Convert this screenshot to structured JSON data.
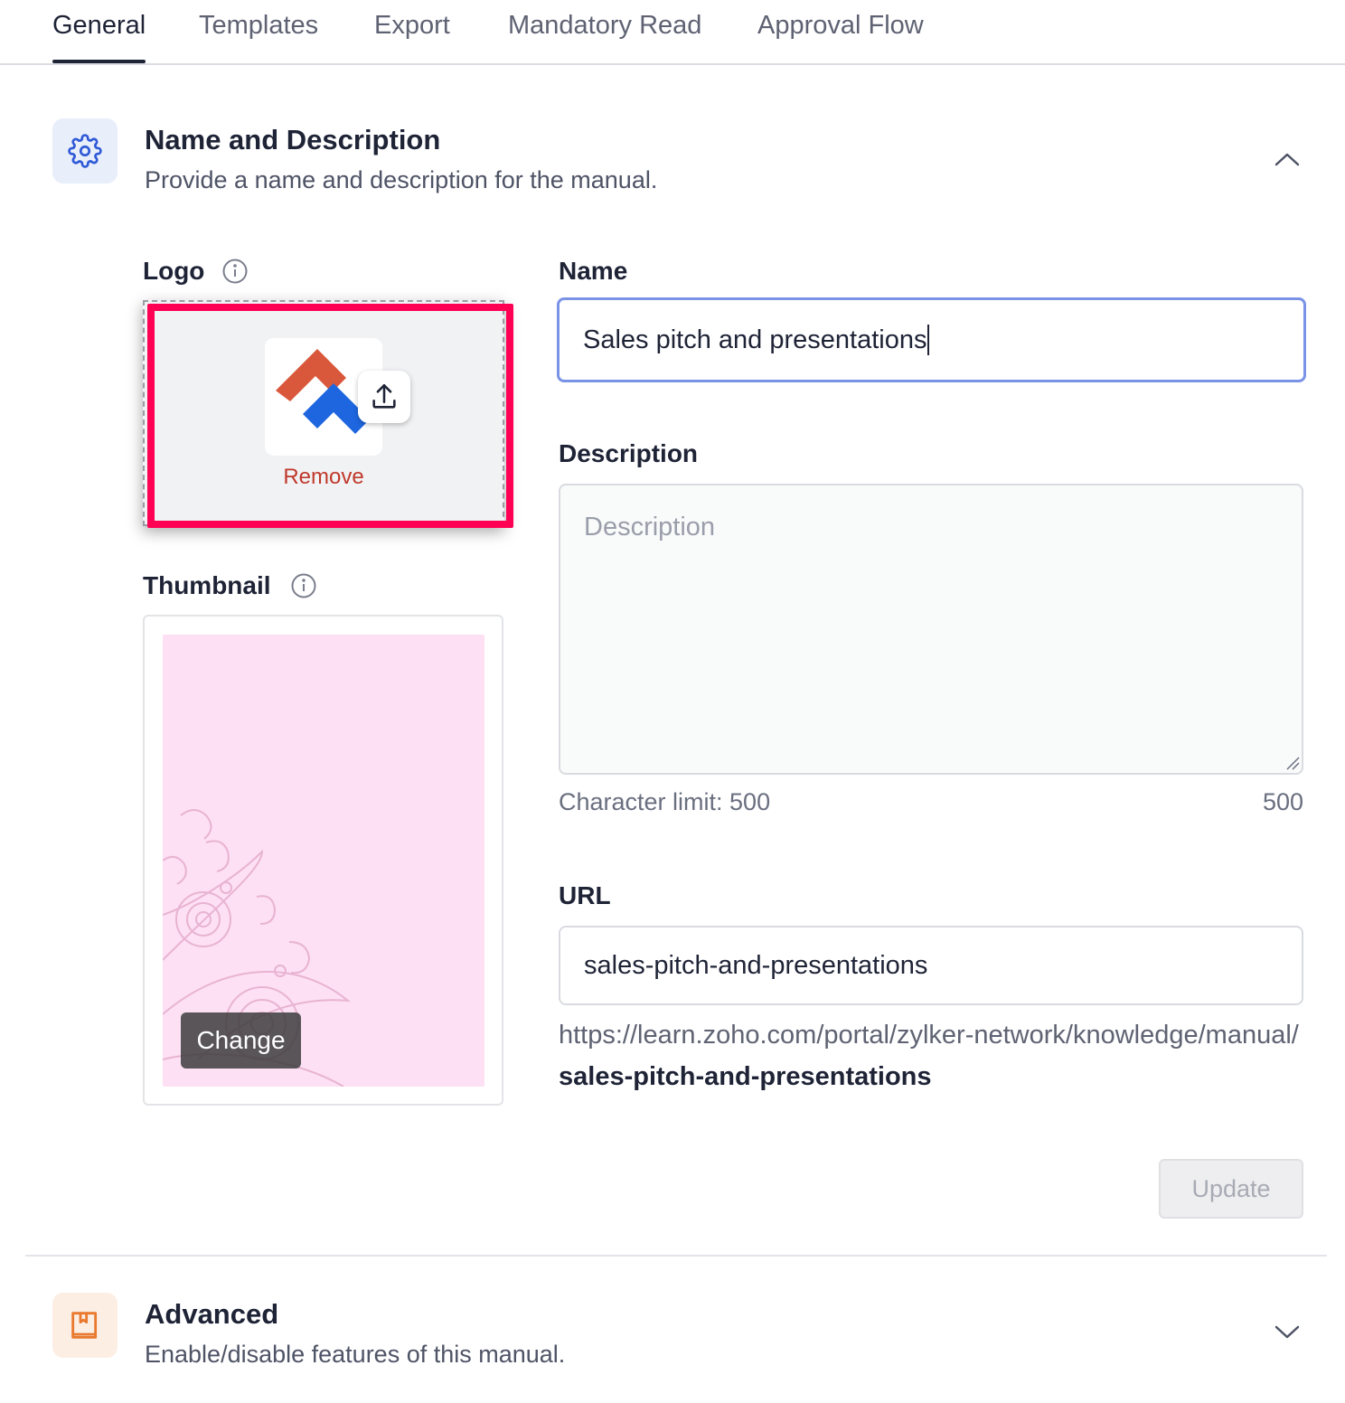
{
  "tabs": [
    {
      "label": "General",
      "active": true
    },
    {
      "label": "Templates",
      "active": false
    },
    {
      "label": "Export",
      "active": false
    },
    {
      "label": "Mandatory Read",
      "active": false
    },
    {
      "label": "Approval Flow",
      "active": false
    }
  ],
  "name_section": {
    "title": "Name and Description",
    "description": "Provide a name and description for the manual.",
    "icon": "gear-icon",
    "expanded": true
  },
  "logo": {
    "label": "Logo",
    "remove_label": "Remove"
  },
  "thumbnail": {
    "label": "Thumbnail",
    "change_label": "Change"
  },
  "name_field": {
    "label": "Name",
    "value": "Sales pitch and presentations"
  },
  "description_field": {
    "label": "Description",
    "placeholder": "Description",
    "value": "",
    "char_limit_text": "Character limit: 500",
    "remaining": "500"
  },
  "url_field": {
    "label": "URL",
    "value": "sales-pitch-and-presentations",
    "preview_base": "https://learn.zoho.com/portal/zylker-network/knowledge/manual/",
    "preview_slug": "sales-pitch-and-presentations"
  },
  "update_button": {
    "label": "Update",
    "enabled": false
  },
  "advanced_section": {
    "title": "Advanced",
    "description": "Enable/disable features of this manual.",
    "icon": "book-icon",
    "expanded": false
  },
  "colors": {
    "accent": "#7b93e6",
    "highlight": "#ff0055",
    "remove": "#c0392b",
    "thumbnail_bg": "#fde0f3"
  }
}
